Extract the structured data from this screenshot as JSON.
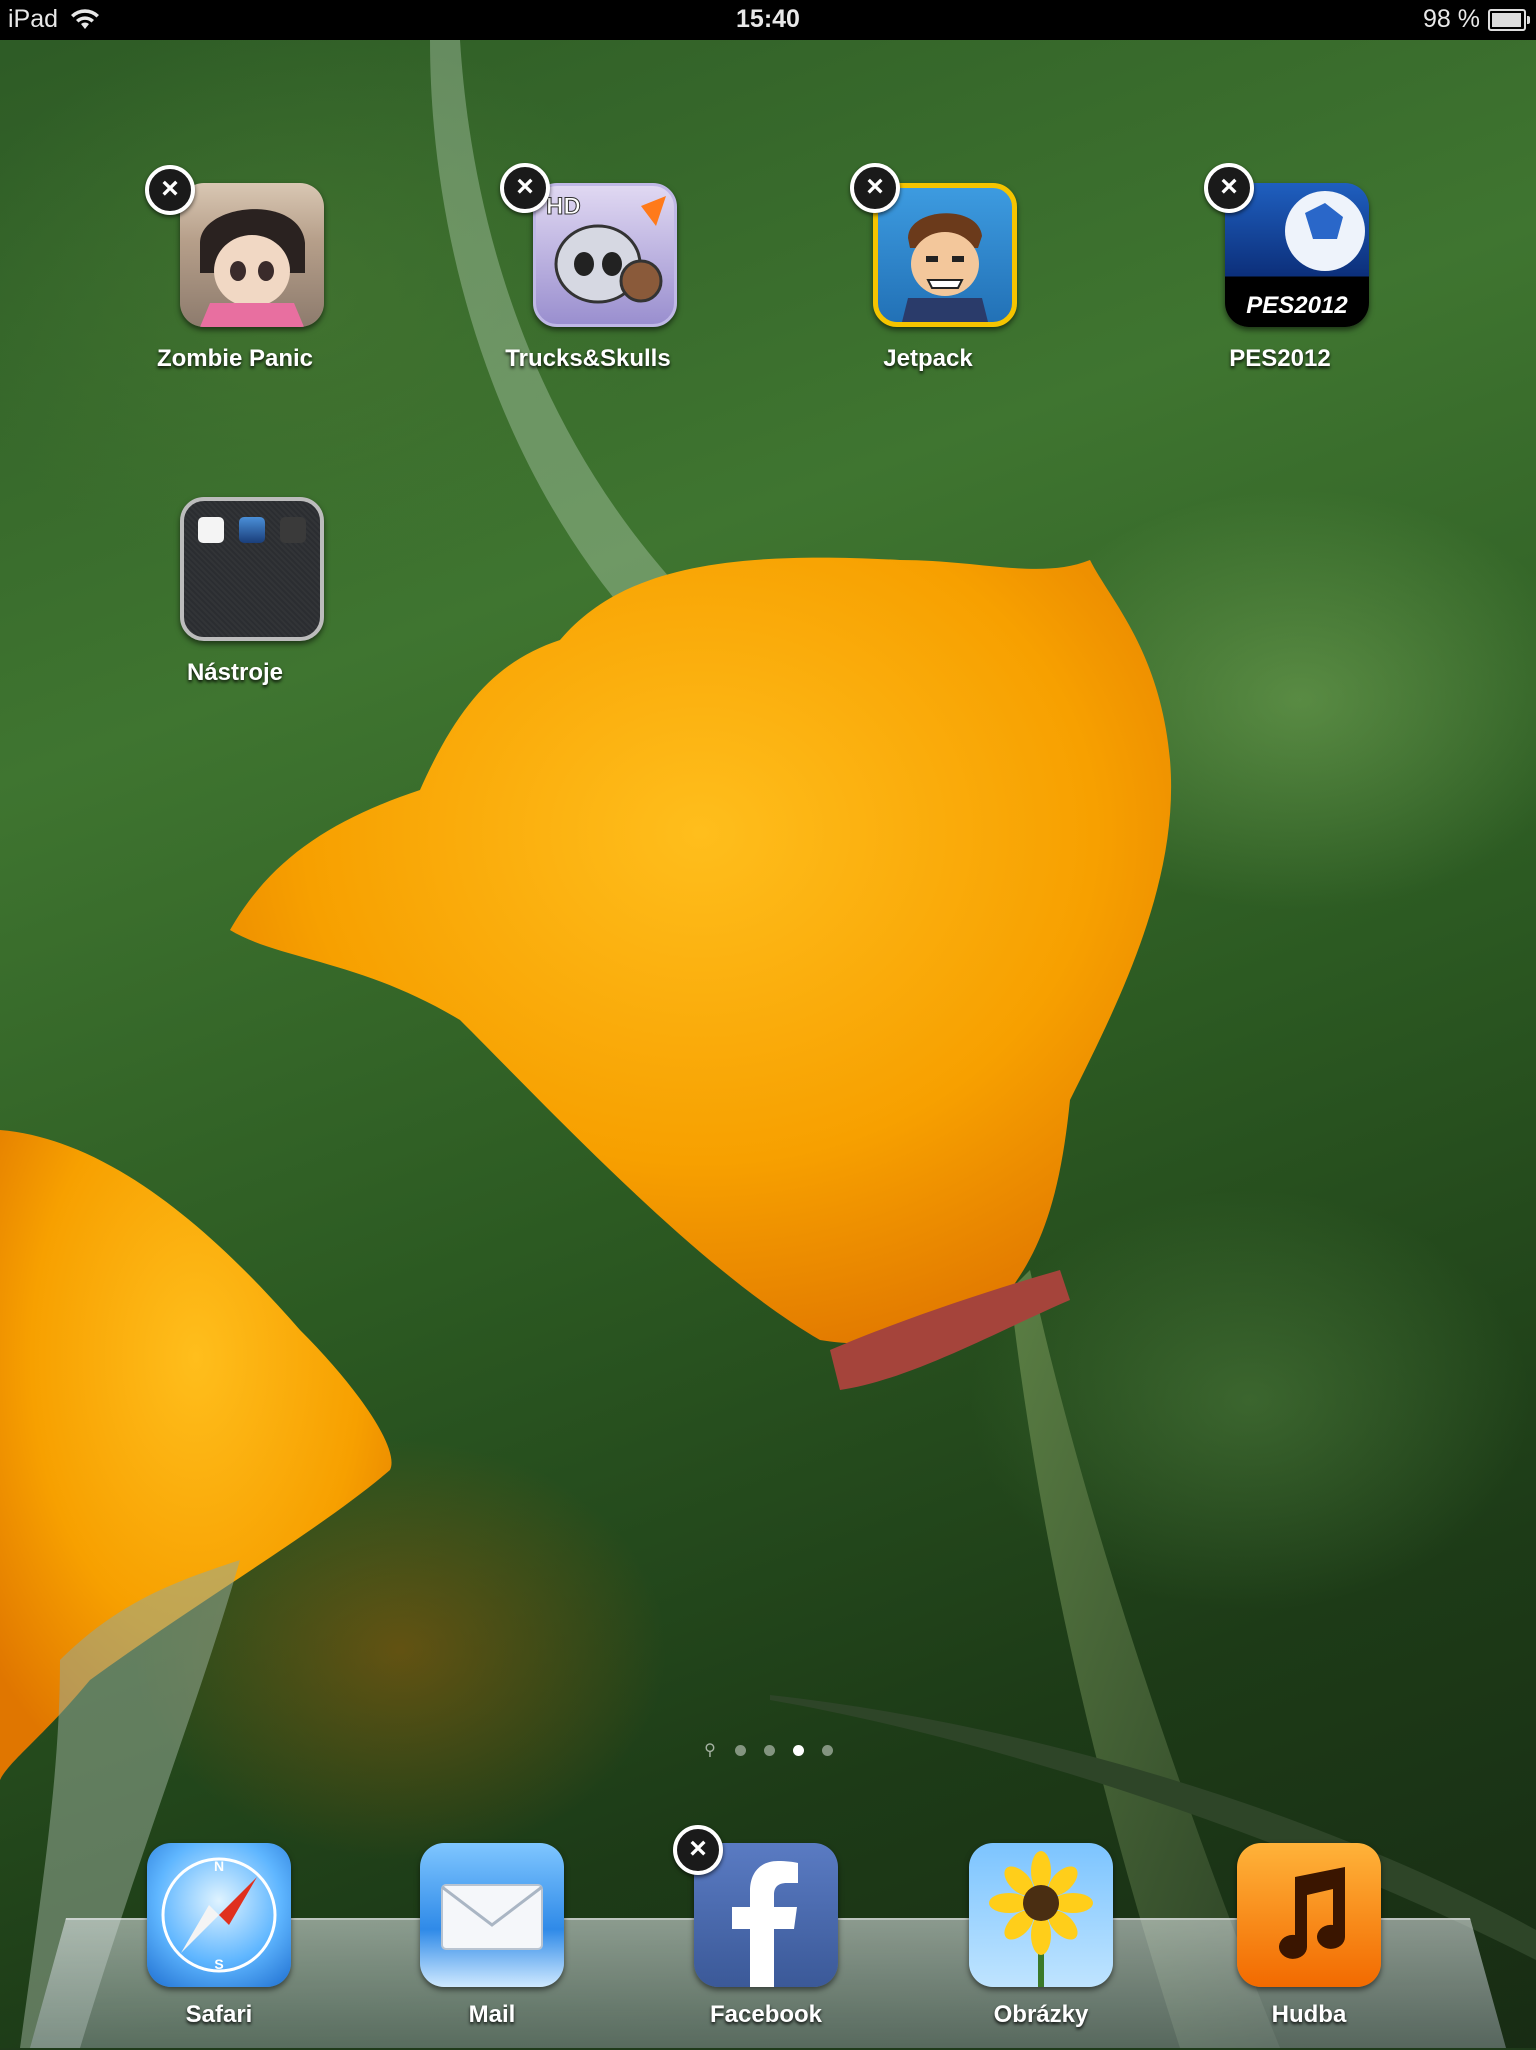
{
  "status_bar": {
    "device": "iPad",
    "time": "15:40",
    "battery_text": "98 %",
    "battery_level": 0.98
  },
  "home_apps": [
    {
      "id": "zombie-panic",
      "label": "Zombie Panic",
      "deletable": true
    },
    {
      "id": "trucks-skulls",
      "label": "Trucks&Skulls",
      "deletable": true,
      "icon_badge": "HD"
    },
    {
      "id": "jetpack",
      "label": "Jetpack",
      "deletable": true
    },
    {
      "id": "pes2012",
      "label": "PES2012",
      "deletable": true,
      "icon_text": "PES2012"
    }
  ],
  "folder": {
    "label": "Nástroje",
    "mini_icons": [
      "Linpack",
      "app-blue",
      "Ax=b"
    ]
  },
  "page_indicator": {
    "pages": 4,
    "active_page": 3,
    "has_search_page": true
  },
  "dock": [
    {
      "id": "safari",
      "label": "Safari",
      "deletable": false
    },
    {
      "id": "mail",
      "label": "Mail",
      "deletable": false
    },
    {
      "id": "facebook",
      "label": "Facebook",
      "deletable": true
    },
    {
      "id": "photos",
      "label": "Obrázky",
      "deletable": false
    },
    {
      "id": "music",
      "label": "Hudba",
      "deletable": false
    }
  ],
  "icons": {
    "delete": "close-x-icon",
    "wifi": "wifi-icon",
    "battery": "battery-icon",
    "search": "search-icon"
  },
  "colors": {
    "status_bar_bg": "#000000",
    "flower": "#f7a800",
    "wallpaper_green": "#3f7530"
  }
}
